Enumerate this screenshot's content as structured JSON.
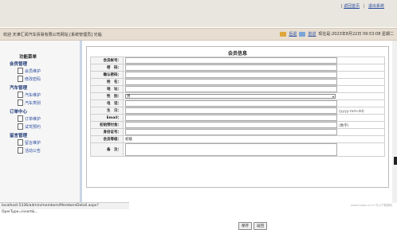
{
  "top_links": {
    "link1": "返回首页",
    "link2": "退出系统",
    "sep": "|"
  },
  "welcome_bar": {
    "left_text": "欢迎 天津汇闻汽车贸易有限公司网站 [系统管理员] 光临",
    "home_label": "后退",
    "logout_label": "前进",
    "status_text": "现在是:2023年8月22日 09:53:08 星期二"
  },
  "sidebar": {
    "title": "功能菜单",
    "groups": [
      {
        "label": "会员管理",
        "items": [
          "会员维护",
          "修改密码"
        ]
      },
      {
        "label": "汽车管理",
        "items": [
          "汽车维护",
          "汽车类别"
        ]
      },
      {
        "label": "订单中心",
        "items": [
          "订单维护",
          "试驾预约"
        ]
      },
      {
        "label": "留言管理",
        "items": [
          "留言维护",
          "活动公告"
        ]
      }
    ]
  },
  "form": {
    "title": "会员信息",
    "fields": {
      "member_no": "会员帐号：",
      "password": "密　码：",
      "confirm_pw": "确认密码：",
      "name": "姓　名：",
      "address": "地　址：",
      "gender": "性　别：",
      "phone": "电　话：",
      "birthday": "生　日：",
      "email": "Email：",
      "deposit": "初始预付金：",
      "id_no": "身份证号：",
      "level": "会员等级：",
      "remark": "备　注："
    },
    "gender_value": "男",
    "birthday_hint": "(yyyy-mm-dd)",
    "deposit_hint": "(数字)",
    "level_value": "初级",
    "buttons": {
      "save": "保存",
      "back": "返回"
    }
  },
  "statusbar": {
    "url": "localhost:5336/admin/members/MembersDetail.aspx?OperType=insert&..."
  },
  "watermark": "www.mapp-co.cn 可以下载源码"
}
